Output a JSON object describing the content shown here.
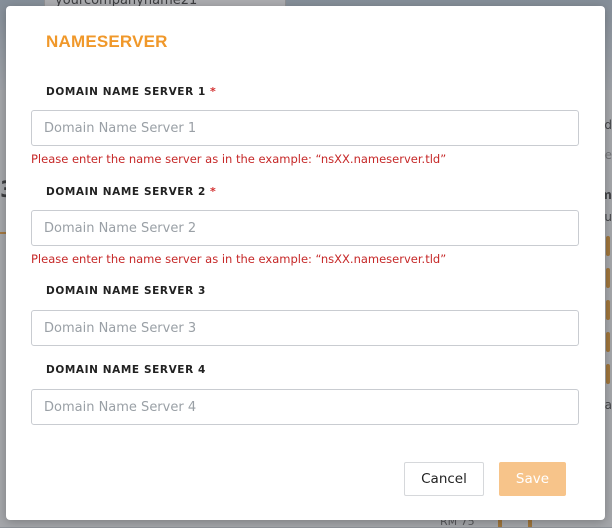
{
  "modal": {
    "title": "NAMESERVER",
    "fields": [
      {
        "label": "DOMAIN NAME SERVER 1",
        "required": "*",
        "placeholder": "Domain Name Server 1",
        "value": "",
        "error": "Please enter the name server as in the example: “nsXX.nameserver.tld”"
      },
      {
        "label": "DOMAIN NAME SERVER 2",
        "required": "*",
        "placeholder": "Domain Name Server 2",
        "value": "",
        "error": "Please enter the name server as in the example: “nsXX.nameserver.tld”"
      },
      {
        "label": "DOMAIN NAME SERVER 3",
        "placeholder": "Domain Name Server 3",
        "value": ""
      },
      {
        "label": "DOMAIN NAME SERVER 4",
        "placeholder": "Domain Name Server 4",
        "value": ""
      }
    ],
    "buttons": {
      "cancel": "Cancel",
      "save": "Save"
    }
  },
  "background": {
    "field_value": "yourcompanyname21",
    "big_char": "3",
    "bottom_text": "RM 75"
  },
  "colors": {
    "accent": "#f0982a",
    "error": "#c62828",
    "save_disabled": "#f7c48a"
  }
}
